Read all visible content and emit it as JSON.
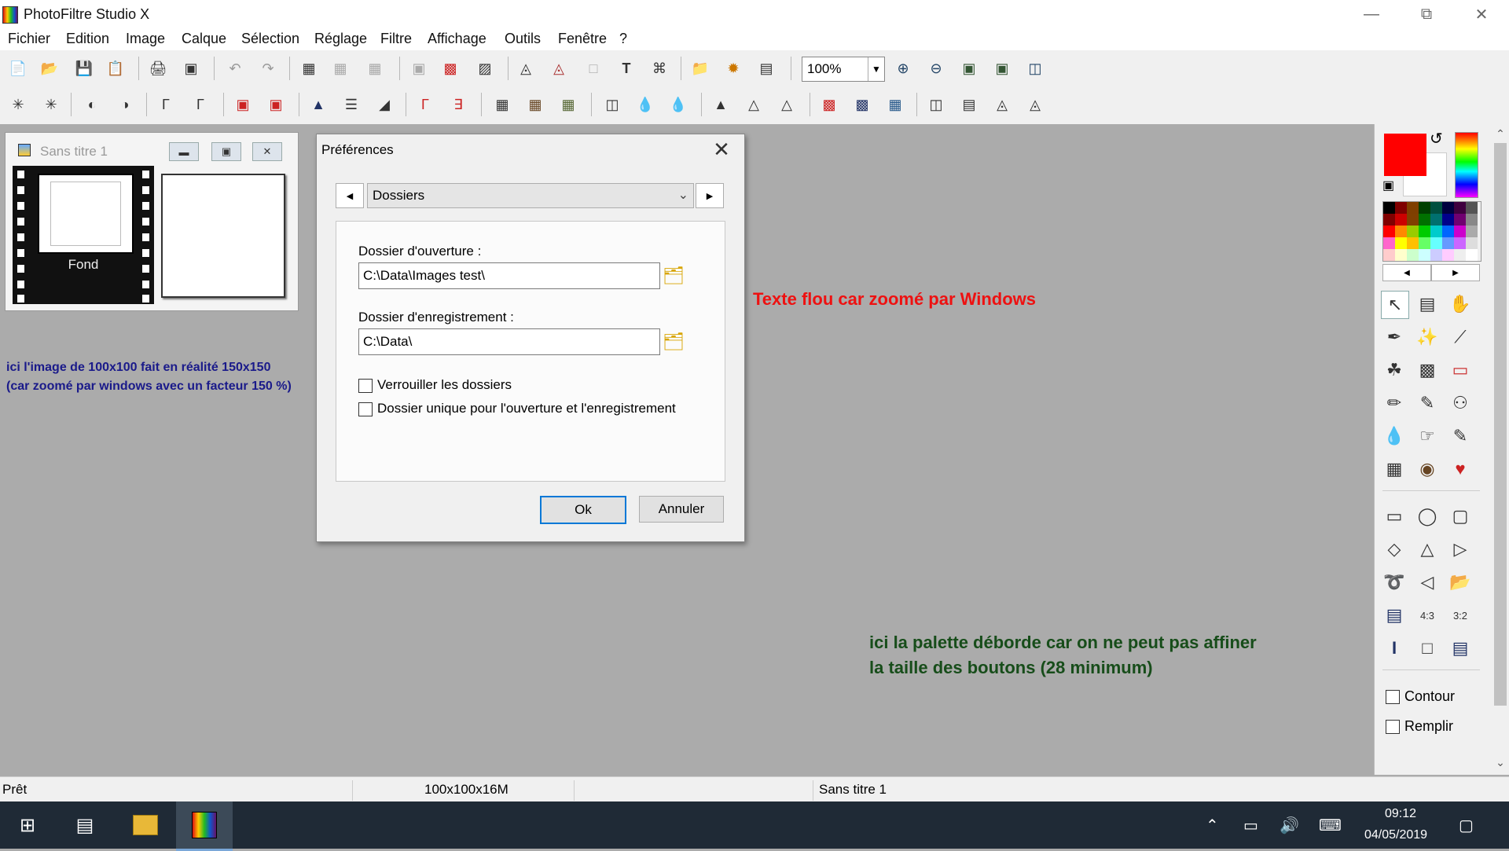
{
  "app": {
    "title": "PhotoFiltre Studio X"
  },
  "menu": [
    "Fichier",
    "Edition",
    "Image",
    "Calque",
    "Sélection",
    "Réglage",
    "Filtre",
    "Affichage",
    "Outils",
    "Fenêtre",
    "?"
  ],
  "toolbar": {
    "zoom_value": "100%"
  },
  "image_window": {
    "title": "Sans titre 1",
    "layer_name": "Fond"
  },
  "notes": {
    "left_line1": "ici l'image de 100x100 fait en réalité 150x150",
    "left_line2": "(car zoomé par windows avec un facteur 150 %)",
    "center": "Texte flou car zoomé par Windows",
    "right_line1": "ici la palette déborde car on ne peut pas affiner",
    "right_line2": "la taille des boutons (28 minimum)"
  },
  "dialog": {
    "title": "Préférences",
    "category": "Dossiers",
    "open_folder_label": "Dossier d'ouverture :",
    "open_folder_value": "C:\\Data\\Images test\\",
    "save_folder_label": "Dossier d'enregistrement :",
    "save_folder_value": "C:\\Data\\",
    "lock_folders_label": "Verrouiller les dossiers",
    "single_folder_label": "Dossier unique pour l'ouverture et l'enregistrement",
    "ok_label": "Ok",
    "cancel_label": "Annuler"
  },
  "palette": {
    "fg_color": "#ff0000",
    "bg_color": "#ffffff",
    "contour_label": "Contour",
    "fill_label": "Remplir"
  },
  "status": {
    "ready": "Prêt",
    "image_size": "100x100x16M",
    "document": "Sans titre 1"
  },
  "taskbar": {
    "time": "09:12",
    "date": "04/05/2019"
  }
}
